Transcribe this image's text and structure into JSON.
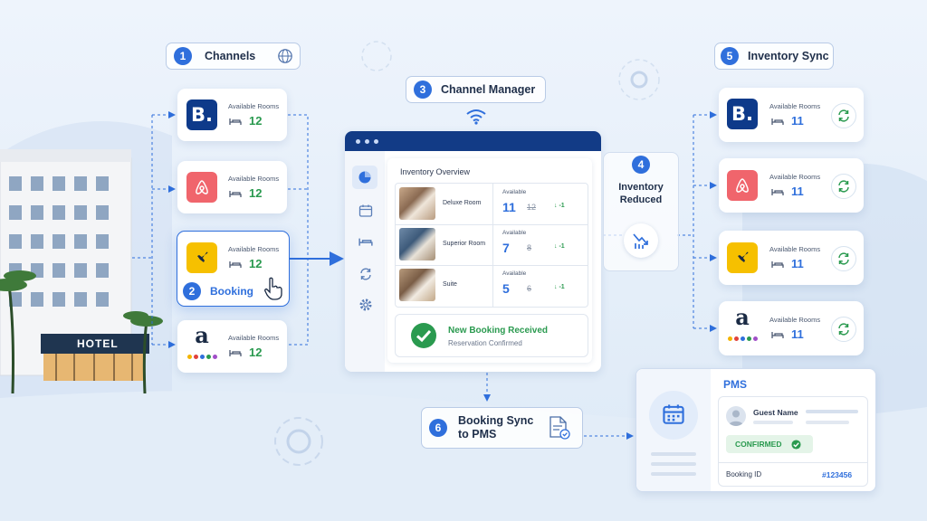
{
  "steps": {
    "channels": {
      "num": "1",
      "label": "Channels"
    },
    "booking": {
      "num": "2",
      "label": "Booking"
    },
    "channel_manager": {
      "num": "3",
      "label": "Channel Manager"
    },
    "inventory_reduced": {
      "num": "4",
      "label_line1": "Inventory",
      "label_line2": "Reduced"
    },
    "inventory_sync": {
      "num": "5",
      "label": "Inventory Sync"
    },
    "booking_sync": {
      "num": "6",
      "label_line1": "Booking Sync",
      "label_line2": "to PMS"
    }
  },
  "hotel_sign": "HOTEL",
  "channels_left": [
    {
      "logo": "booking",
      "logo_text": "B.",
      "label": "Available Rooms",
      "value": "12"
    },
    {
      "logo": "airbnb",
      "label": "Available Rooms",
      "value": "12"
    },
    {
      "logo": "jet",
      "label": "Available Rooms",
      "value": "12"
    },
    {
      "logo": "amazon",
      "logo_text": "a",
      "label": "Available Rooms",
      "value": "12"
    }
  ],
  "channels_right": [
    {
      "logo": "booking",
      "logo_text": "B.",
      "label": "Available Rooms",
      "value": "11"
    },
    {
      "logo": "airbnb",
      "label": "Available Rooms",
      "value": "11"
    },
    {
      "logo": "jet",
      "label": "Available Rooms",
      "value": "11"
    },
    {
      "logo": "amazon",
      "logo_text": "a",
      "label": "Available Rooms",
      "value": "11"
    }
  ],
  "inventory": {
    "title": "Inventory Overview",
    "rows": [
      {
        "name": "Deluxe Room",
        "avail_label": "Available",
        "new": "11",
        "old": "12",
        "delta": "-1"
      },
      {
        "name": "Superior Room",
        "avail_label": "Available",
        "new": "7",
        "old": "8",
        "delta": "-1"
      },
      {
        "name": "Suite",
        "avail_label": "Available",
        "new": "5",
        "old": "6",
        "delta": "-1"
      }
    ],
    "notice_title": "New Booking Received",
    "notice_sub": "Reservation Confirmed"
  },
  "pms": {
    "title": "PMS",
    "guest_label": "Guest Name",
    "status": "CONFIRMED",
    "booking_id_label": "Booking ID",
    "booking_id": "#123456"
  },
  "colors": {
    "accent": "#2f6fdc",
    "green": "#2a9a4f",
    "navy": "#0e3a8a",
    "airbnb": "#f0656c",
    "jet": "#f6c000"
  }
}
